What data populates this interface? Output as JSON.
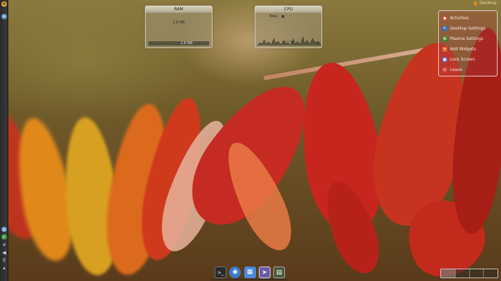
{
  "screen": {
    "description_colors": {
      "accent": "#c8322a",
      "panel": "#2b2b2b"
    }
  },
  "left_panel": {
    "top_icons": [
      {
        "name": "kde-menu-icon"
      },
      {
        "name": "activity-icon"
      }
    ],
    "bottom_icons": [
      {
        "name": "network-icon"
      },
      {
        "name": "update-ok-icon"
      },
      {
        "name": "tools-icon"
      },
      {
        "name": "volume-icon"
      },
      {
        "name": "usb-icon"
      },
      {
        "name": "power-icon"
      }
    ]
  },
  "widgets": {
    "ram": {
      "title": "RAM",
      "value": "1.8 MB",
      "bar_value": "1.8 MB"
    },
    "cpu": {
      "title": "CPU",
      "label": "Total",
      "value": "8.1 %"
    }
  },
  "menu": {
    "items": [
      {
        "label": "Activities",
        "icon": "activities-icon",
        "color": "#d24a3a"
      },
      {
        "label": "Desktop Settings",
        "icon": "desktop-settings-icon",
        "color": "#2f6fb8"
      },
      {
        "label": "Plasma Settings",
        "icon": "plasma-settings-icon",
        "color": "#3a8a3a"
      },
      {
        "label": "Add Widgets",
        "icon": "add-widgets-icon",
        "color": "#e06a2a"
      },
      {
        "label": "Lock Screen",
        "icon": "lock-icon",
        "color": "#5a6ad0"
      },
      {
        "label": "Leave",
        "icon": "leave-icon",
        "color": "#d04040"
      }
    ]
  },
  "top_right": {
    "label": "Desktop"
  },
  "dock": {
    "items": [
      {
        "name": "terminal-icon",
        "glyph": ">_",
        "color": "#2a2a2a"
      },
      {
        "name": "browser-icon",
        "glyph": "◉",
        "color": "#3a7ac8"
      },
      {
        "name": "file-manager-icon",
        "glyph": "▦",
        "color": "#4a8ad8"
      },
      {
        "name": "cursor-icon",
        "glyph": "➤",
        "color": "#6a5aa8"
      },
      {
        "name": "system-monitor-icon",
        "glyph": "▤",
        "color": "#4a5a3a"
      }
    ]
  }
}
